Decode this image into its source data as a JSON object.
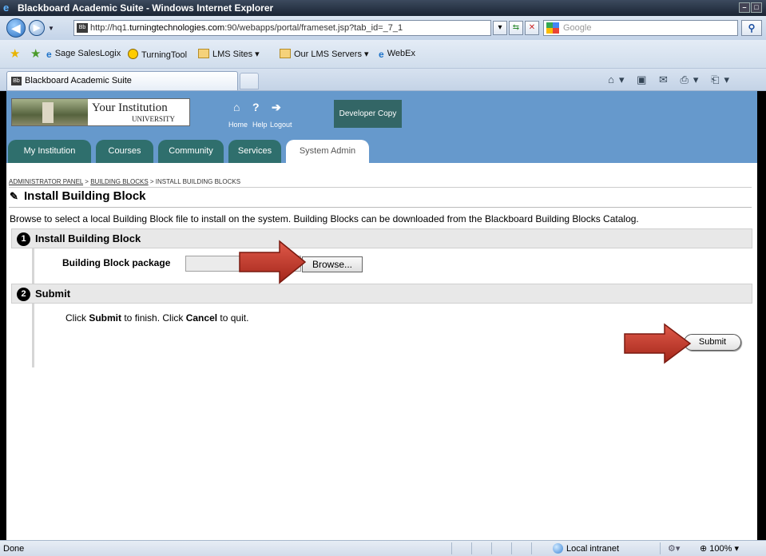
{
  "window": {
    "title": "Blackboard Academic Suite - Windows Internet Explorer"
  },
  "address": {
    "url_prefix": "http://hq1.",
    "url_host": "turningtechnologies.com",
    "url_rest": ":90/webapps/portal/frameset.jsp?tab_id=_7_1",
    "search_placeholder": "Google"
  },
  "favorites": {
    "items": [
      "Sage SalesLogix",
      "TurningTool",
      "LMS Sites ▾",
      "Our LMS Servers ▾",
      "WebEx"
    ]
  },
  "ie_tab": {
    "label": "Blackboard Academic Suite"
  },
  "bb_header": {
    "institution": "Your Institution",
    "university": "UNIVERSITY",
    "icons": [
      {
        "icon": "home-icon",
        "label": "Home"
      },
      {
        "icon": "help-icon",
        "label": "Help"
      },
      {
        "icon": "logout-icon",
        "label": "Logout"
      }
    ],
    "developer_copy": "Developer Copy",
    "tabs": [
      "My Institution",
      "Courses",
      "Community",
      "Services",
      "System Admin"
    ],
    "active_tab": "System Admin"
  },
  "breadcrumb": {
    "admin_panel": "ADMINISTRATOR PANEL",
    "sep1": " > ",
    "building_blocks": "BUILDING BLOCKS",
    "sep2": " > ",
    "current": "INSTALL BUILDING BLOCKS"
  },
  "page": {
    "title": "Install Building Block",
    "description": "Browse to select a local Building Block file to install on the system. Building Blocks can be downloaded from the Blackboard Building Blocks Catalog.",
    "section1": {
      "number": "1",
      "title": "Install Building Block",
      "field_label": "Building Block package",
      "browse_label": "Browse..."
    },
    "section2": {
      "number": "2",
      "title": "Submit",
      "text_click": "Click ",
      "text_submit": "Submit",
      "text_mid": " to finish. Click ",
      "text_cancel": "Cancel",
      "text_end": " to quit.",
      "submit_label": "Submit"
    }
  },
  "statusbar": {
    "status": "Done",
    "zone": "Local intranet",
    "zoom": "100%"
  },
  "colors": {
    "bb_header": "#6699cc",
    "bb_tab": "#2f6f6d",
    "arrow": "#c0392b"
  }
}
